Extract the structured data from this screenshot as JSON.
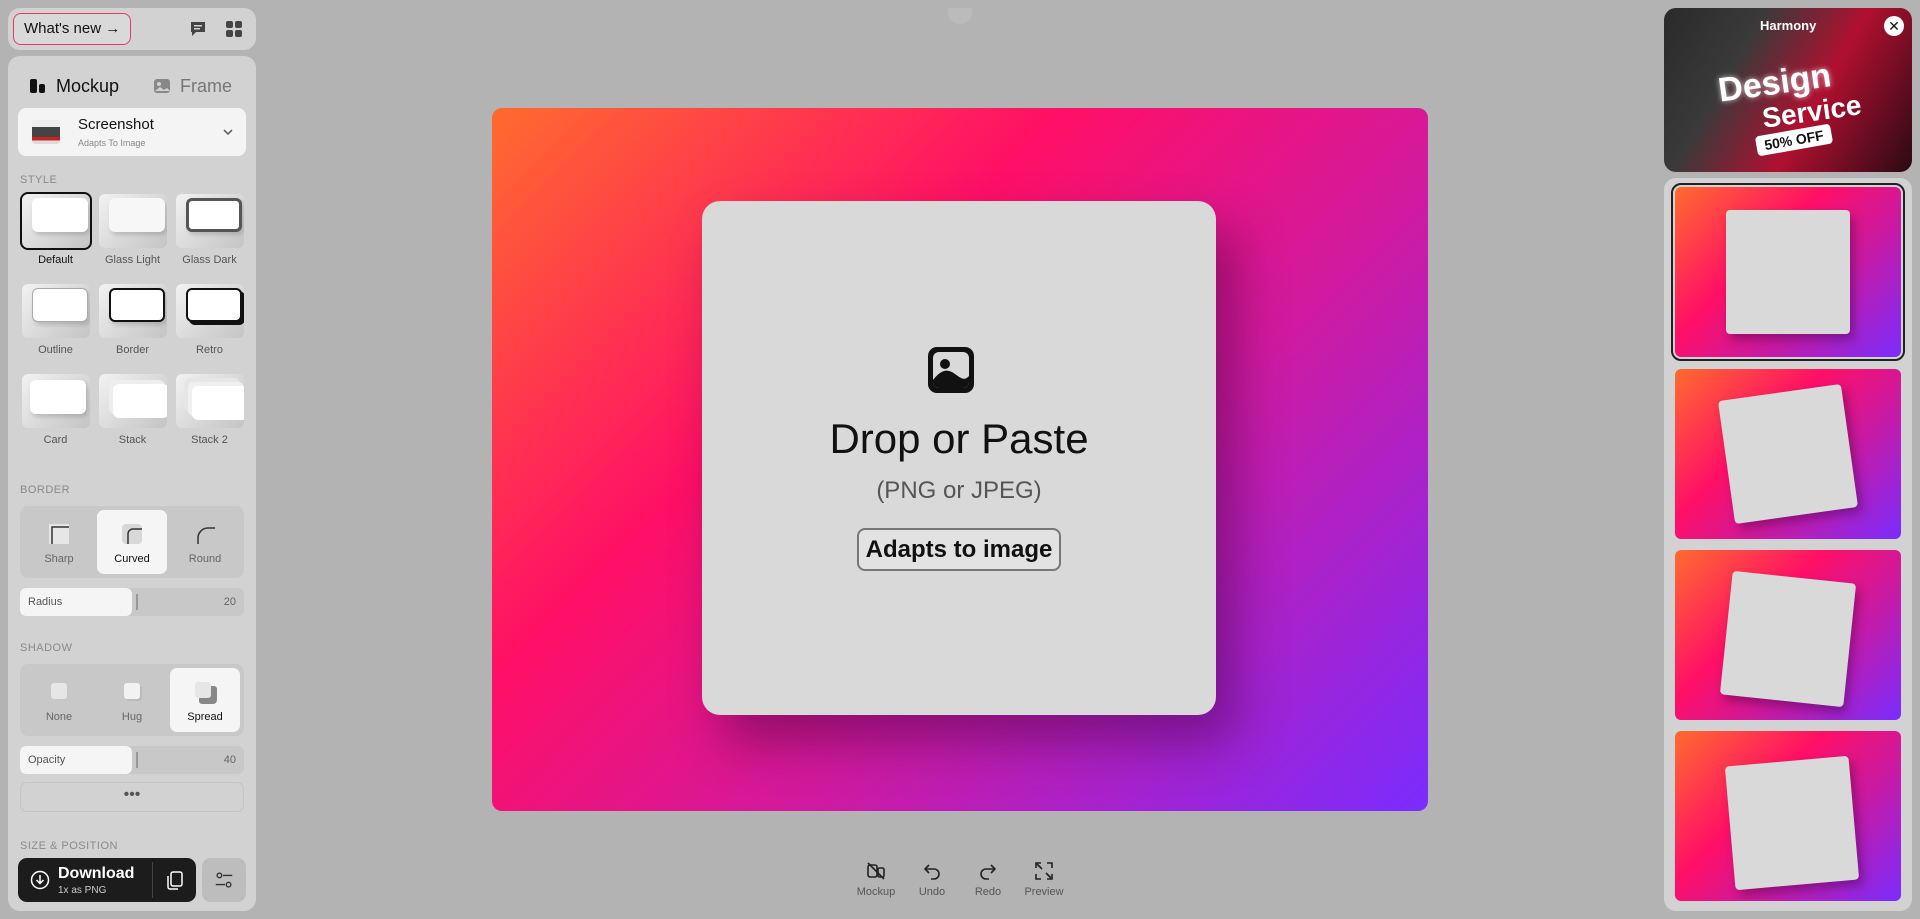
{
  "topbar": {
    "whats_new": "What's new →",
    "icons": [
      "message-icon",
      "grid-icon"
    ]
  },
  "mode_tabs": [
    {
      "label": "Mockup",
      "active": true
    },
    {
      "label": "Frame",
      "active": false
    }
  ],
  "device": {
    "title": "Screenshot",
    "subtitle": "Adapts To Image"
  },
  "style": {
    "label": "STYLE",
    "items": [
      {
        "label": "Default",
        "selected": true
      },
      {
        "label": "Glass Light"
      },
      {
        "label": "Glass Dark"
      },
      {
        "label": "Outline"
      },
      {
        "label": "Border"
      },
      {
        "label": "Retro"
      },
      {
        "label": "Card"
      },
      {
        "label": "Stack"
      },
      {
        "label": "Stack 2"
      }
    ]
  },
  "border": {
    "label": "BORDER",
    "options": [
      {
        "label": "Sharp"
      },
      {
        "label": "Curved",
        "active": true
      },
      {
        "label": "Round"
      }
    ],
    "radius": {
      "label": "Radius",
      "value": "20"
    }
  },
  "shadow": {
    "label": "SHADOW",
    "options": [
      {
        "label": "None"
      },
      {
        "label": "Hug"
      },
      {
        "label": "Spread",
        "active": true
      }
    ],
    "opacity": {
      "label": "Opacity",
      "value": "40"
    }
  },
  "more": "•••",
  "size_position": {
    "label": "SIZE & POSITION"
  },
  "download": {
    "title": "Download",
    "subtitle": "1x as PNG"
  },
  "canvas": {
    "title": "Drop or Paste",
    "subtitle": "(PNG or JPEG)",
    "button": "Adapts to image",
    "gradient": [
      "#ff6b2e",
      "#ff0f66",
      "#d01aa0",
      "#7a2cff"
    ]
  },
  "toolbar": [
    {
      "label": "Mockup",
      "icon": "mockup-off-icon"
    },
    {
      "label": "Undo",
      "icon": "undo-icon"
    },
    {
      "label": "Redo",
      "icon": "redo-icon"
    },
    {
      "label": "Preview",
      "icon": "expand-icon"
    }
  ],
  "ad": {
    "brand": "Harmony",
    "line1": "Design",
    "line2": "Service",
    "badge": "50% OFF"
  },
  "presets": [
    {
      "name": "Flat",
      "selected": true
    },
    {
      "name": "Tilted right"
    },
    {
      "name": "Tilted left"
    },
    {
      "name": "Tilted slight"
    }
  ]
}
